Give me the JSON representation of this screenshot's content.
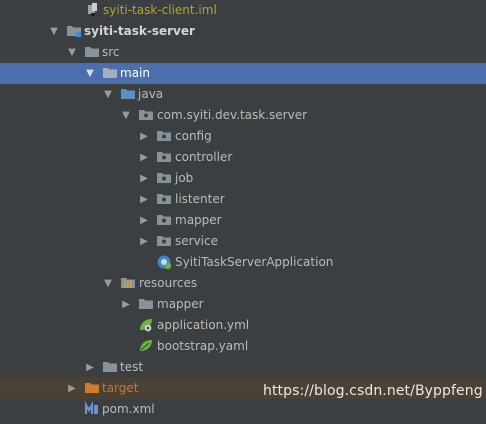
{
  "tree": {
    "rows": [
      {
        "label": "syiti-task-client.iml",
        "icon": "iml-file-icon",
        "expanded": null
      },
      {
        "label": "syiti-task-server",
        "icon": "module-folder-icon",
        "expanded": true
      },
      {
        "label": "src",
        "icon": "folder-icon",
        "expanded": true
      },
      {
        "label": "main",
        "icon": "folder-icon",
        "expanded": true,
        "selected": true
      },
      {
        "label": "java",
        "icon": "source-root-folder-icon",
        "expanded": true
      },
      {
        "label": "com.syiti.dev.task.server",
        "icon": "package-icon",
        "expanded": true
      },
      {
        "label": "config",
        "icon": "package-icon",
        "expanded": false
      },
      {
        "label": "controller",
        "icon": "package-icon",
        "expanded": false
      },
      {
        "label": "job",
        "icon": "package-icon",
        "expanded": false
      },
      {
        "label": "listenter",
        "icon": "package-icon",
        "expanded": false
      },
      {
        "label": "mapper",
        "icon": "package-icon",
        "expanded": false
      },
      {
        "label": "service",
        "icon": "package-icon",
        "expanded": false
      },
      {
        "label": "SyitiTaskServerApplication",
        "icon": "spring-boot-class-icon",
        "expanded": null
      },
      {
        "label": "resources",
        "icon": "resources-root-folder-icon",
        "expanded": true
      },
      {
        "label": "mapper",
        "icon": "folder-icon",
        "expanded": false
      },
      {
        "label": "application.yml",
        "icon": "spring-config-file-icon",
        "expanded": null
      },
      {
        "label": "bootstrap.yaml",
        "icon": "yaml-leaf-icon",
        "expanded": null
      },
      {
        "label": "test",
        "icon": "folder-icon",
        "expanded": false
      },
      {
        "label": "target",
        "icon": "excluded-folder-icon",
        "expanded": false,
        "excluded": true
      },
      {
        "label": "pom.xml",
        "icon": "maven-file-icon",
        "expanded": null
      }
    ]
  },
  "watermark": {
    "text": "https://blog.csdn.net/Byppfeng"
  },
  "colors": {
    "background": "#3c3f41",
    "selection": "#4b6eaf",
    "excluded_row": "#4c4135",
    "folder": "#87939a",
    "source_root": "#5f8fbf",
    "target_folder": "#d27a2c",
    "spring_green": "#6db33f"
  }
}
